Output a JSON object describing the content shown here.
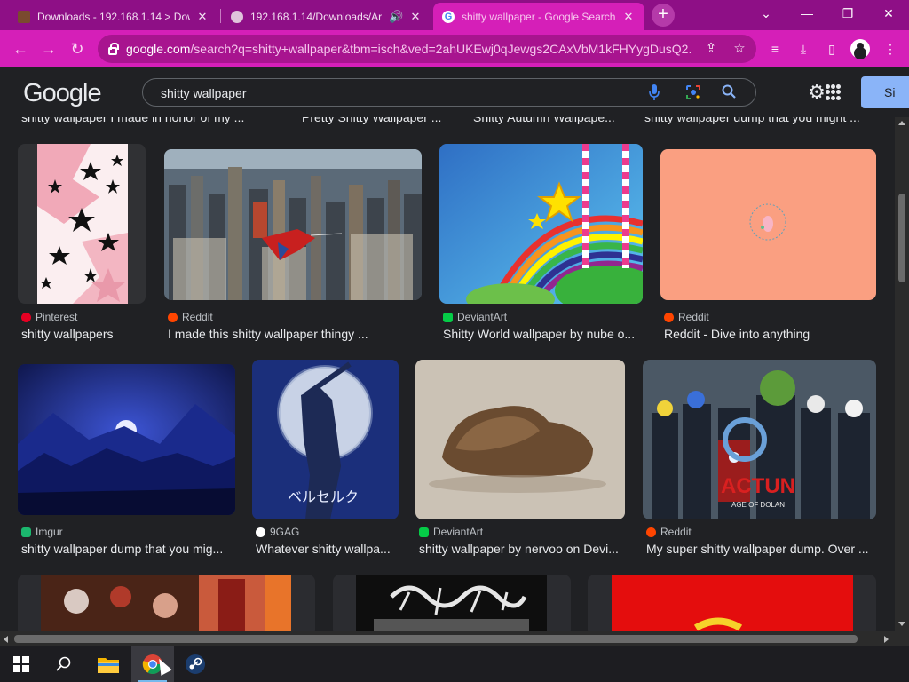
{
  "browser": {
    "tabs": [
      {
        "title": "Downloads - 192.168.1.14 > Dow",
        "icon": "folder-icon",
        "active": false
      },
      {
        "title": "192.168.1.14/Downloads/Ar",
        "icon": "globe-icon",
        "active": false,
        "audio": true
      },
      {
        "title": "shitty wallpaper - Google Search",
        "icon": "google-icon",
        "active": true
      }
    ],
    "new_tab_label": "+",
    "window_controls": {
      "tab_list": "⌄",
      "minimize": "—",
      "maximize": "❐",
      "close": "✕"
    },
    "address": {
      "host": "google.com",
      "path": "/search?q=shitty+wallpaper&tbm=isch&ved=2ahUKEwj0qJewgs2CAxVbM1kFHYygDusQ2..."
    }
  },
  "google": {
    "logo": [
      "G",
      "o",
      "o",
      "g",
      "l",
      "e"
    ],
    "logo_colors": [
      "#e8eaed",
      "#e8eaed",
      "#e8eaed",
      "#e8eaed",
      "#e8eaed",
      "#e8eaed"
    ],
    "query": "shitty wallpaper",
    "signin_label": "Si"
  },
  "top_captions": [
    "shitty wallpaper I made in honor of my ...",
    "Pretty Shitty Wallpaper ...",
    "Shitty Autumn Wallpape...",
    "shitty wallpaper dump that you might ..."
  ],
  "results": [
    {
      "source": "Pinterest",
      "source_color": "#e60023",
      "caption": "shitty wallpapers"
    },
    {
      "source": "Reddit",
      "source_color": "#ff4500",
      "caption": "I made this shitty wallpaper thingy ..."
    },
    {
      "source": "DeviantArt",
      "source_color": "#05cc47",
      "caption": "Shitty World wallpaper by nube o..."
    },
    {
      "source": "Reddit",
      "source_color": "#ff4500",
      "caption": "Reddit - Dive into anything"
    },
    {
      "source": "Imgur",
      "source_color": "#1bb76e",
      "caption": "shitty wallpaper dump that you mig..."
    },
    {
      "source": "9GAG",
      "source_color": "#ffffff",
      "caption": "Whatever shitty wallpa..."
    },
    {
      "source": "DeviantArt",
      "source_color": "#05cc47",
      "caption": "shitty wallpaper by nervoo on Devi..."
    },
    {
      "source": "Reddit",
      "source_color": "#ff4500",
      "caption": "My super shitty wallpaper dump. Over ..."
    }
  ],
  "taskbar": {
    "items": [
      "windows-start-icon",
      "search-icon",
      "file-explorer-icon",
      "chrome-icon",
      "steam-icon"
    ]
  }
}
